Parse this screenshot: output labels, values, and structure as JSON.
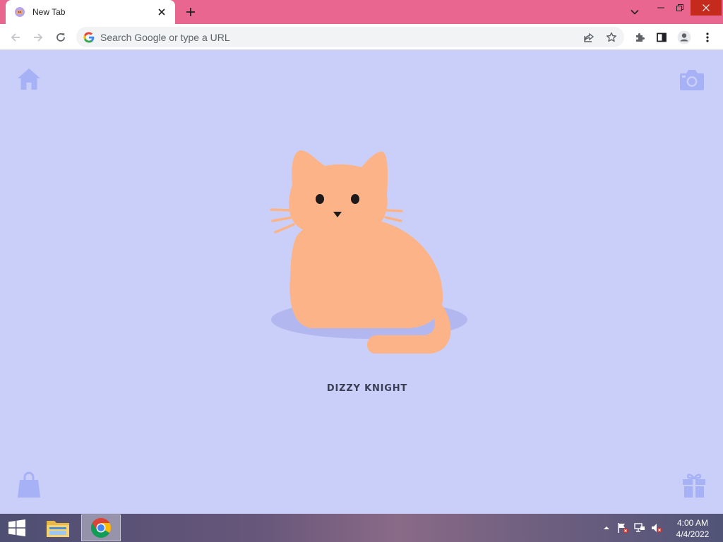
{
  "browser": {
    "tab": {
      "title": "New Tab"
    },
    "omnibox": {
      "placeholder": "Search Google or type a URL"
    }
  },
  "page": {
    "cat_name": "DIZZY KNIGHT",
    "corner_icons": [
      "home-icon",
      "camera-icon",
      "shopping-bag-icon",
      "gift-icon"
    ]
  },
  "taskbar": {
    "pinned": [
      "file-explorer-icon",
      "chrome-icon"
    ],
    "clock": {
      "time": "4:00 AM",
      "date": "4/4/2022"
    }
  },
  "colors": {
    "tab_strip": "#e8668f",
    "page_background": "#cacffa",
    "corner_icon": "#a7b1f5",
    "cat_fur": "#fcb387",
    "cat_shadow": "#b2b8ef",
    "cat_name_text": "#3a3f54"
  }
}
